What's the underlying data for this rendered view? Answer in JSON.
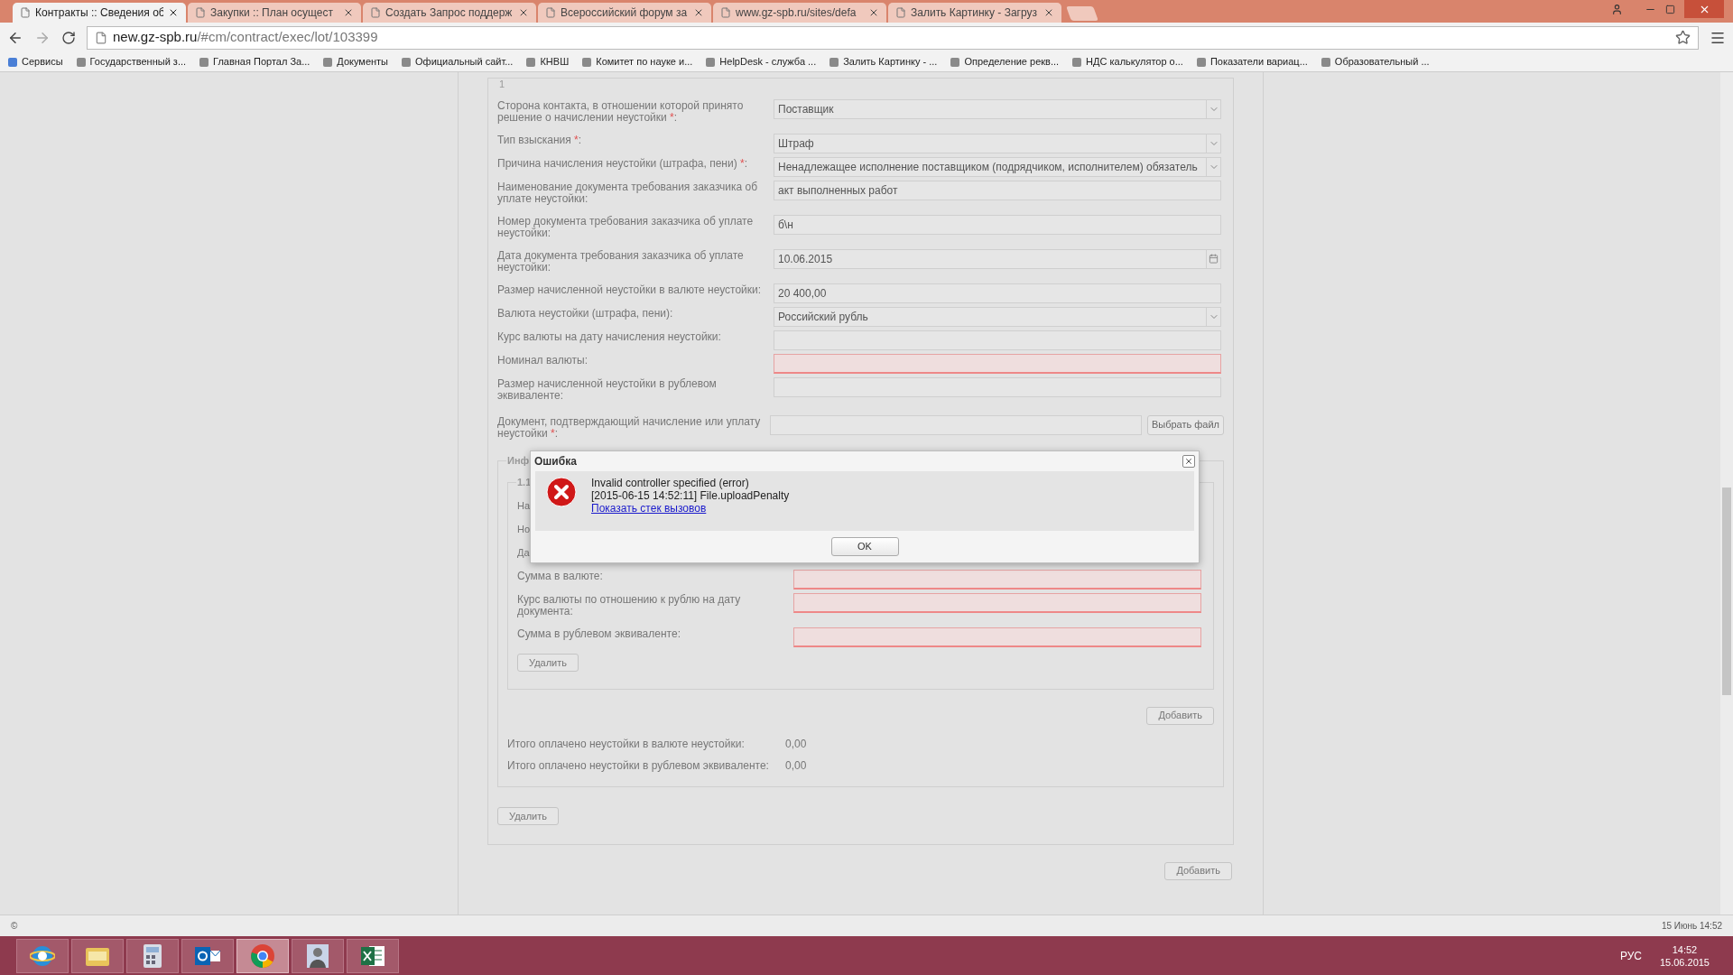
{
  "tabs": [
    {
      "label": "Контракты :: Сведения об",
      "selected": true
    },
    {
      "label": "Закупки :: План осущест",
      "selected": false
    },
    {
      "label": "Создать Запрос поддерж",
      "selected": false
    },
    {
      "label": "Всероссийский форум за",
      "selected": false
    },
    {
      "label": "www.gz-spb.ru/sites/defa",
      "selected": false
    },
    {
      "label": "Залить Картинку - Загруз",
      "selected": false
    }
  ],
  "address": {
    "host": "new.gz-spb.ru",
    "path": "/#cm/contract/exec/lot/103399"
  },
  "bookmarks": [
    "Сервисы",
    "Государственный з...",
    "Главная Портал За...",
    "Документы",
    "Официальный сайт...",
    "КНВШ",
    "Комитет по науке и...",
    "HelpDesk - служба ...",
    "Залить Картинку - ...",
    "Определение рекв...",
    "НДС калькулятор о...",
    "Показатели вариац...",
    "Образовательный ..."
  ],
  "form": {
    "legend": "1",
    "fields": [
      {
        "kind": "select",
        "label": "Сторона контакта, в отношении которой принято решение о начислении неустойки ",
        "asterisk": "*",
        "label_end": ":",
        "value": "Поставщик",
        "invalid": false
      },
      {
        "kind": "select",
        "label": "Тип взыскания ",
        "asterisk": "*",
        "label_end": ":",
        "value": "Штраф",
        "invalid": false
      },
      {
        "kind": "select",
        "label": "Причина начисления неустойки (штрафа, пени) ",
        "asterisk": "*",
        "label_end": ":",
        "value": "Ненадлежащее исполнение поставщиком (подрядчиком, исполнителем) обязатель",
        "invalid": false
      },
      {
        "kind": "text",
        "label": "Наименование документа требования заказчика об уплате неустойки:",
        "value": "акт выполненных работ",
        "invalid": false
      },
      {
        "kind": "text",
        "label": "Номер документа требования заказчика об уплате неустойки:",
        "value": "б\\н",
        "invalid": false
      },
      {
        "kind": "date",
        "label": "Дата документа требования заказчика об уплате неустойки:",
        "value": "10.06.2015",
        "invalid": false
      },
      {
        "kind": "text",
        "label": "Размер начисленной неустойки в валюте неустойки:",
        "value": "20 400,00",
        "invalid": false
      },
      {
        "kind": "select",
        "label": "Валюта неустойки (штрафа, пени):",
        "value": "Российский рубль",
        "invalid": false
      },
      {
        "kind": "text",
        "label": "Курс валюты на дату начисления неустойки:",
        "invalid": false
      },
      {
        "kind": "text",
        "label": "Номинал валюты:",
        "invalid": true
      },
      {
        "kind": "text",
        "label": "Размер начисленной неустойки в рублевом эквиваленте:",
        "invalid": false
      },
      {
        "kind": "file",
        "label": "Документ, подтверждающий начисление или уплату неустойки ",
        "asterisk": "*",
        "label_end": ":",
        "button": "Выбрать файл",
        "invalid": false
      }
    ],
    "payments": {
      "legend": "Инф",
      "item_legend": "1.1",
      "hidden_labels": [
        "На",
        "Но",
        "Да"
      ],
      "fields": [
        {
          "label": "Сумма в валюте:",
          "invalid": true
        },
        {
          "label": "Курс валюты по отношению к рублю на дату документа:",
          "invalid": true
        },
        {
          "label": "Сумма в рублевом эквиваленте:",
          "invalid": true
        }
      ],
      "delete_button": "Удалить",
      "add_button": "Добавить",
      "totals": [
        {
          "label": "Итого оплачено неустойки в валюте неустойки:",
          "value": "0,00"
        },
        {
          "label": "Итого оплачено неустойки в рублевом эквиваленте:",
          "value": "0,00"
        }
      ]
    },
    "delete_button": "Удалить"
  },
  "add_button": "Добавить",
  "dialog": {
    "title": "Ошибка",
    "lines": [
      "Invalid controller specified (error)",
      "[2015-06-15 14:52:11] File.uploadPenalty"
    ],
    "link": "Показать стек вызовов",
    "ok": "OK"
  },
  "status_bar": {
    "left": "©",
    "right": "15 Июнь 14:52"
  },
  "taskbar": {
    "apps": [
      {
        "kind": "browser-e",
        "selected": false
      },
      {
        "kind": "folder",
        "selected": false
      },
      {
        "kind": "calculator",
        "selected": false
      },
      {
        "kind": "mail",
        "selected": false
      },
      {
        "kind": "chrome",
        "selected": true
      },
      {
        "kind": "person",
        "selected": false
      },
      {
        "kind": "sheet",
        "selected": false
      }
    ],
    "language": "РУС",
    "time": "14:52",
    "date": "15.06.2015"
  }
}
